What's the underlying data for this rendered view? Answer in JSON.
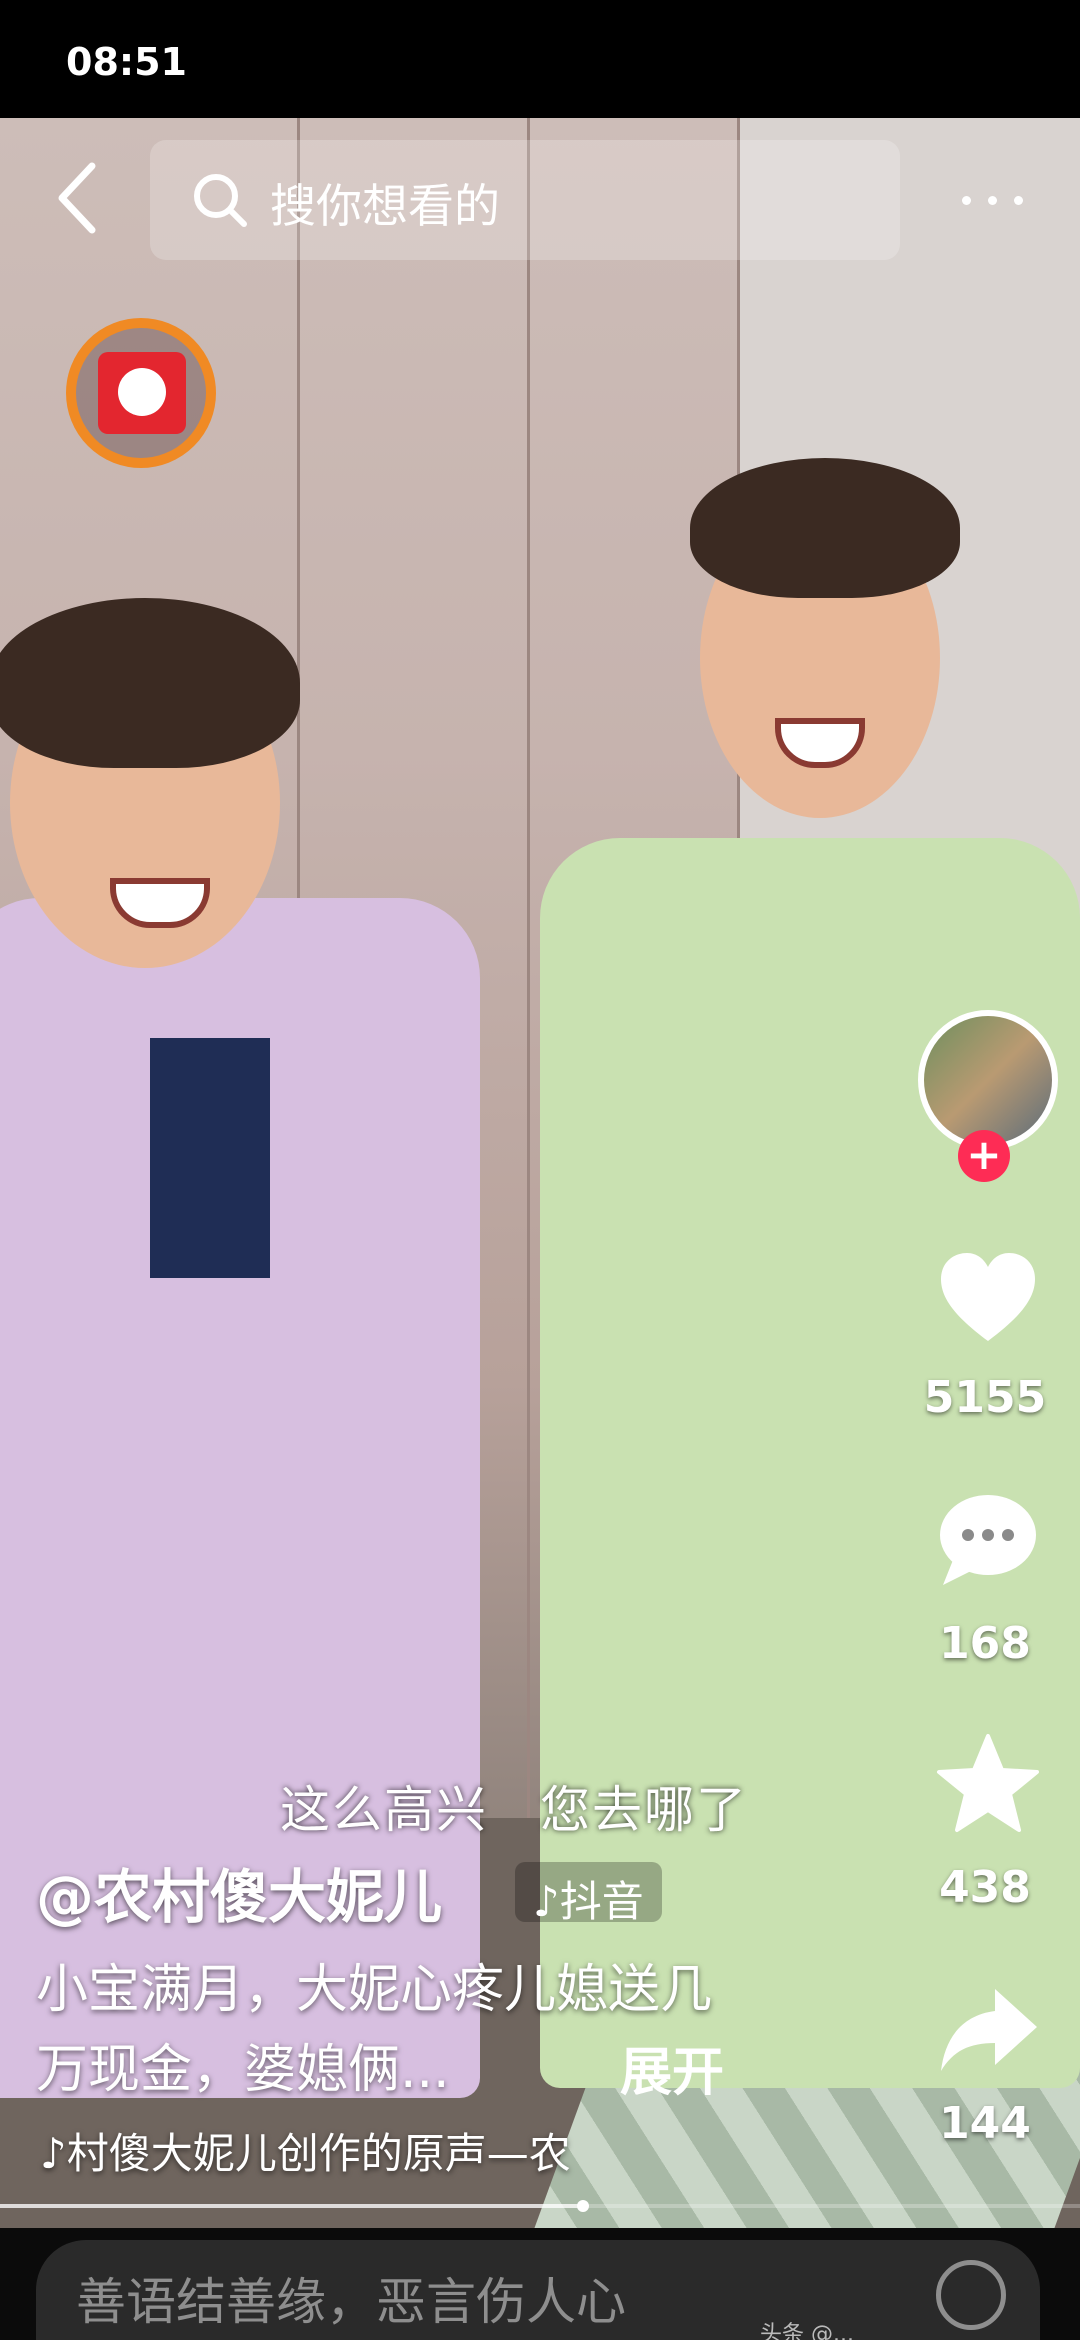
{
  "status_bar": {
    "time": "08:51"
  },
  "top_nav": {
    "search_placeholder": "搜你想看的"
  },
  "rail": {
    "like_count": "5155",
    "comment_count": "168",
    "favorite_count": "438",
    "share_count": "144"
  },
  "caption": {
    "subtitle": "这么高兴　您去哪了",
    "author": "@农村傻大妮儿",
    "source_tag": "♪抖音",
    "description": "小宝满月，大妮心疼儿媳送几万现金，婆媳俩...",
    "expand_label": "展开",
    "music": "♪村傻大妮儿创作的原声—农"
  },
  "progress": {
    "fraction": 0.54
  },
  "bottom_bar": {
    "comment_placeholder": "善语结善缘，恶言伤人心",
    "watermark": "头条 @..."
  },
  "colors": {
    "accent_red": "#fe2c55",
    "redpacket_ring": "#f08a24"
  }
}
